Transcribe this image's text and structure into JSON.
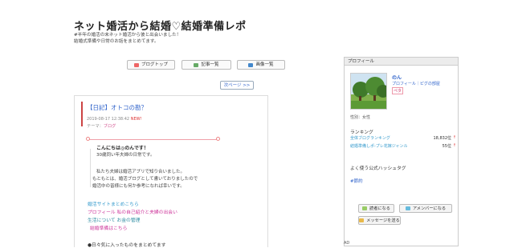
{
  "blog": {
    "title": "ネット婚活から結婚♡結婚準備レポ",
    "desc1": "#半年の婚活の末ネット婚活から彼と出会いました！",
    "desc2": "結婚式準備や日常のお話をまとめてます。"
  },
  "nav": {
    "top": "ブログトップ",
    "list": "記事一覧",
    "images": "画像一覧",
    "next": "次ページ >>"
  },
  "article": {
    "title": "【日記】オトコの勘？",
    "date": "2019-08-17 12:38:42",
    "new_badge": "NEW!",
    "theme_label": "テーマ：",
    "theme": "ブログ",
    "greeting": "こんにちは◎のんです！",
    "line1": "30歳同い年夫婦の日常です。",
    "line2": "私たち夫婦は婚活アプリで知り合いました。",
    "line3": "もともとは、婚活ブログとして書いておりましたので",
    "line4": "婚活中の皆様にも何か参考になれば幸いです。",
    "link1": "婚活サイトまとめこちら",
    "link2": "プロフィール 私の自己紹介と夫婦の出会い",
    "link3": "生活について お金の管理",
    "link4": "結婚準備はこちら",
    "footer": "●日々気に入ったものをまとめてます"
  },
  "sidebar": {
    "header": "プロフィール",
    "name": "のん",
    "links": "プロフィール｜ピグの部屋",
    "tag": "ペタ",
    "gender": "性別：女性",
    "ranking_head": "ランキング",
    "rank1_label": "全体ブログランキング",
    "rank1_value": "18,832位",
    "rank2_label": "結婚準備しポ-プレ花嫁ジャンル",
    "rank2_value": "55位",
    "tag_head": "よく使う公式ハッシュタグ",
    "tag1": "#節約",
    "btn_reader": "読者になる",
    "btn_amember": "アメンバーになる",
    "btn_message": "メッセージを送る",
    "ad": "AD"
  }
}
